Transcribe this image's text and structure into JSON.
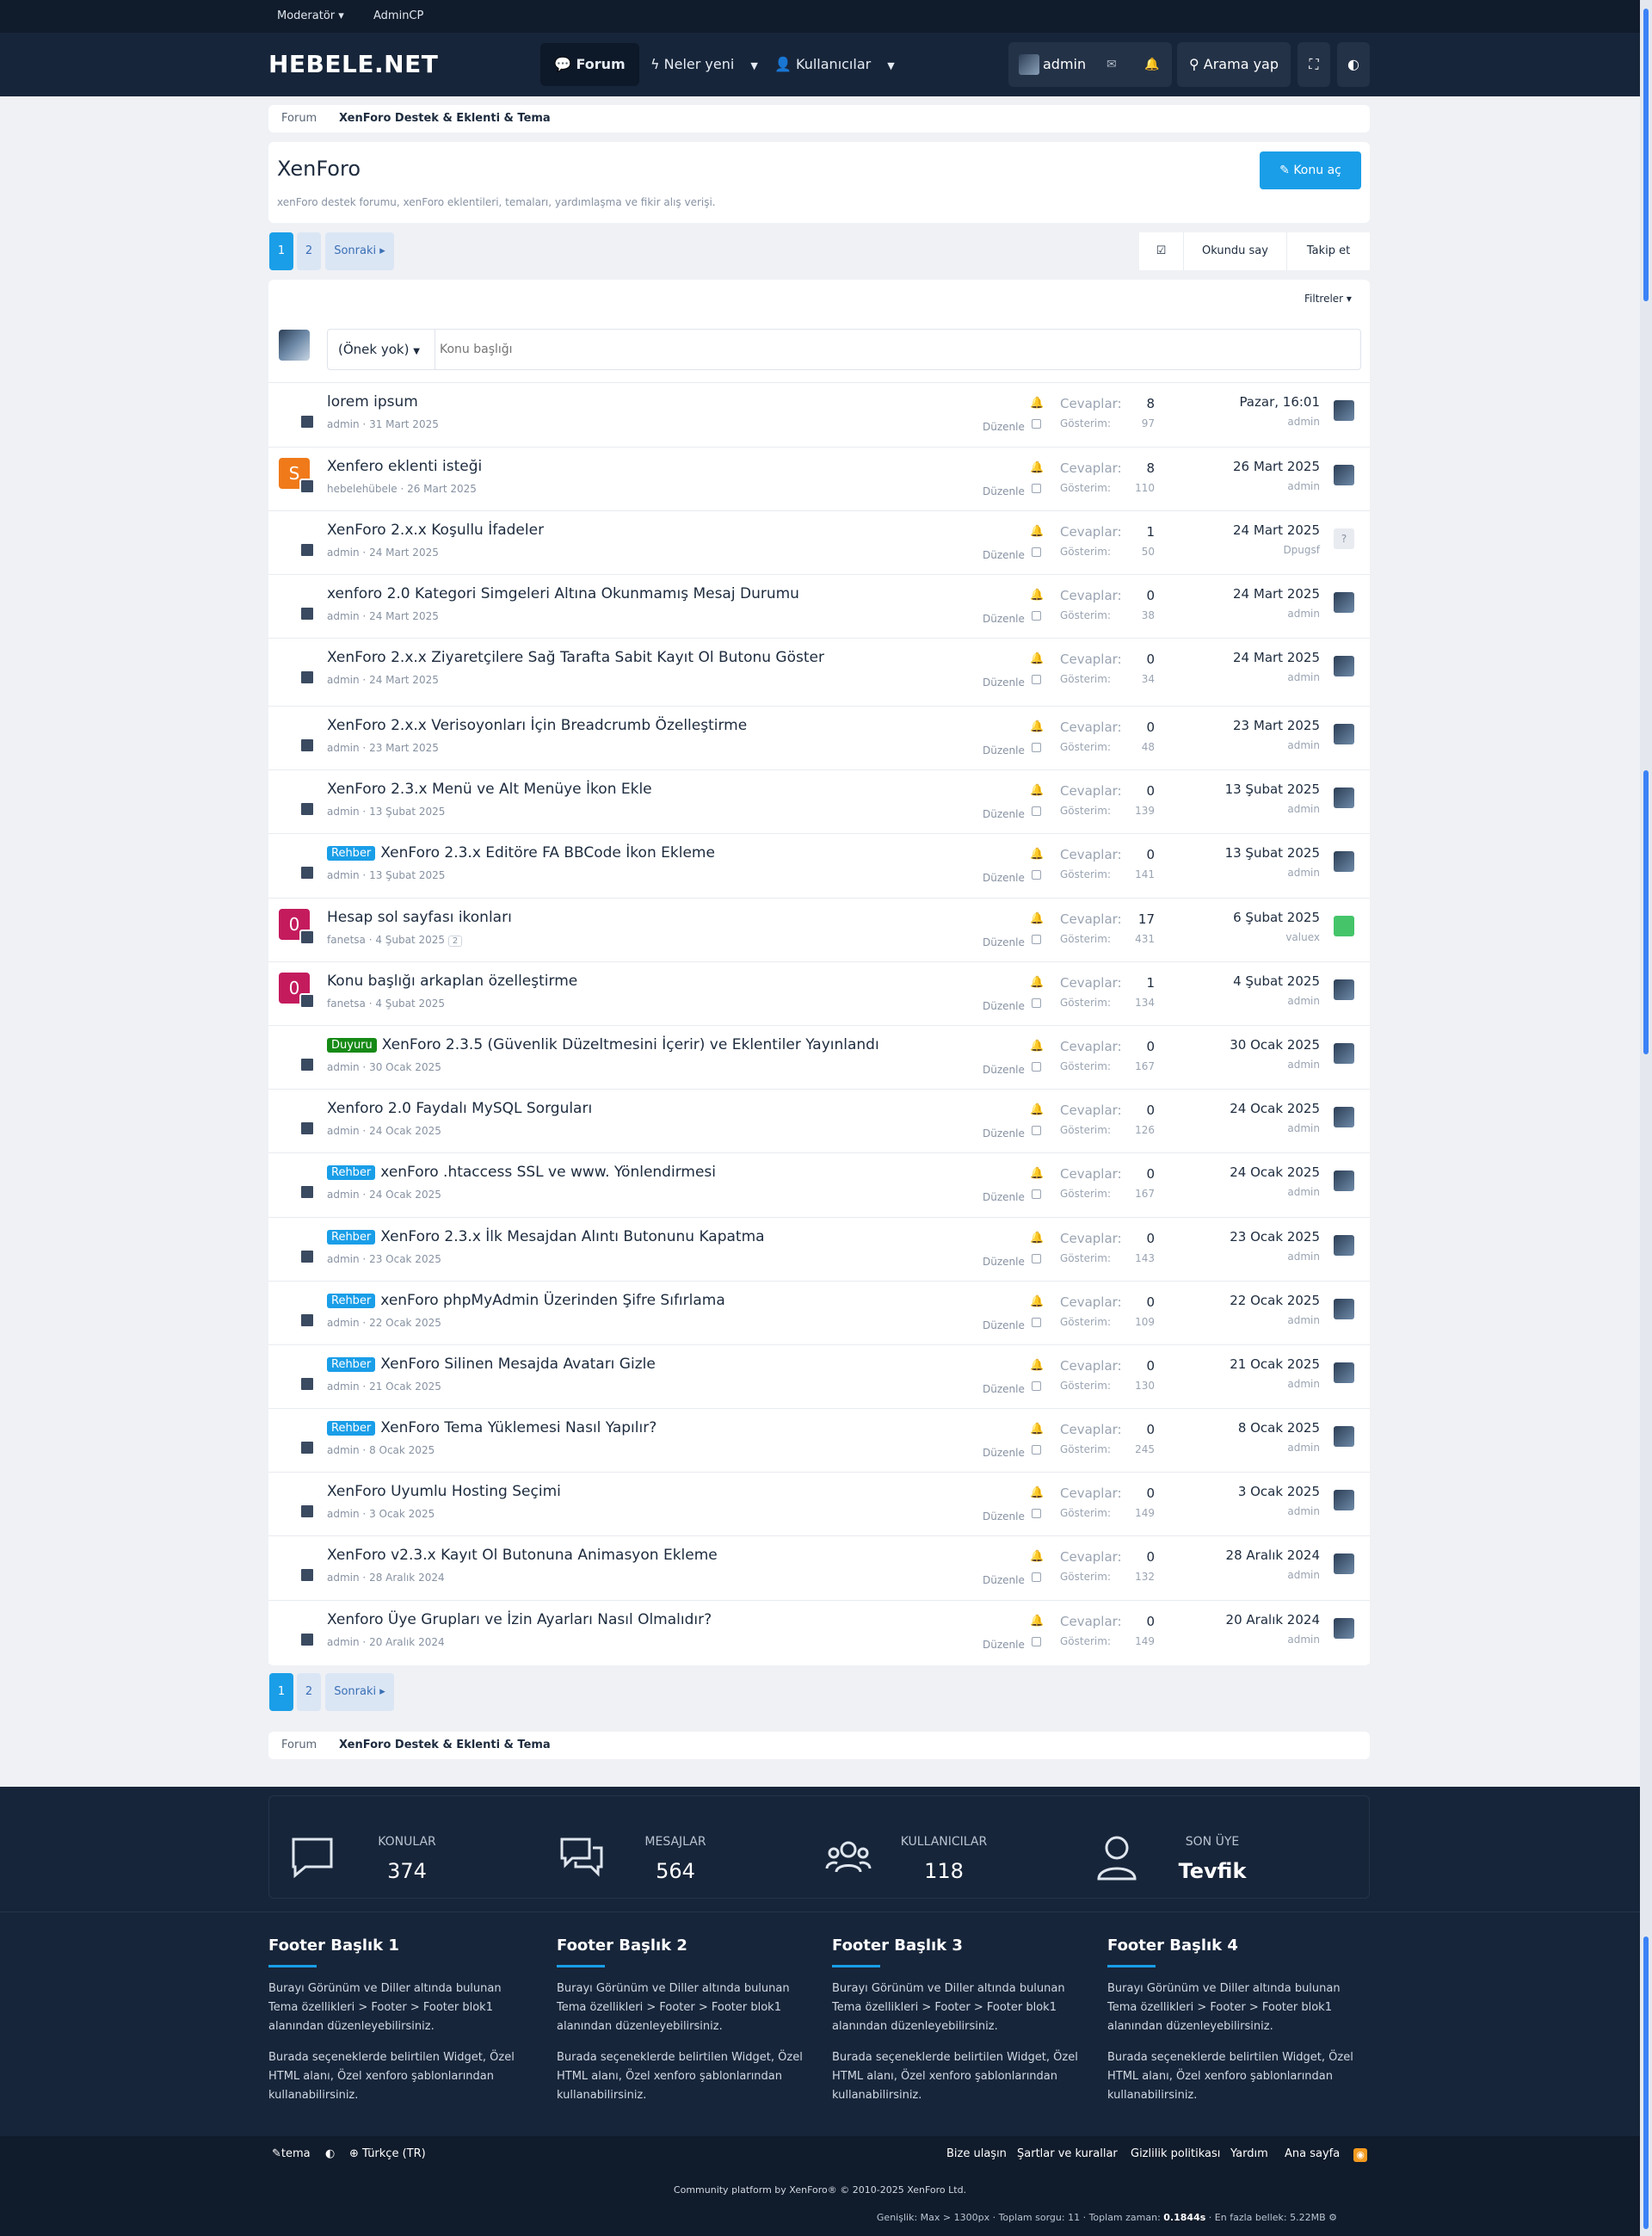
{
  "staffbar": {
    "moderator": "Moderatör ▾",
    "admincp": "AdminCP"
  },
  "nav": {
    "logo": "HEBELE.NET",
    "tabs": [
      {
        "label": "Forum"
      },
      {
        "label": "Neler yeni"
      },
      {
        "label": "Kullanıcılar"
      }
    ],
    "user": "admin",
    "search": "Arama yap"
  },
  "breadcrumb": {
    "root": "Forum",
    "current": "XenForo Destek & Eklenti & Tema"
  },
  "header": {
    "title": "XenForo",
    "description": "xenForo destek forumu, xenForo eklentileri, temaları, yardımlaşma ve fikir alış verişi.",
    "new_thread": "Konu aç"
  },
  "pagination": {
    "pages": [
      "1",
      "2"
    ],
    "next": "Sonraki ▸"
  },
  "actions": {
    "mark_read": "Okundu say",
    "watch": "Takip et",
    "filters": "Filtreler ▾"
  },
  "quick": {
    "prefix": "(Önek yok)",
    "placeholder": "Konu başlığı"
  },
  "labels": {
    "replies": "Cevaplar:",
    "views": "Gösterim:",
    "edit": "Düzenle"
  },
  "threads": [
    {
      "prefix": "",
      "prefix_color": "",
      "title": "lorem ipsum",
      "author": "admin",
      "date": "31 Mart 2025",
      "replies": "8",
      "views": "97",
      "last_date": "Pazar, 16:01",
      "last_user": "admin",
      "avatar": "img",
      "last_avatar": "img",
      "pages": ""
    },
    {
      "prefix": "",
      "prefix_color": "",
      "title": "Xenfero eklenti isteği",
      "author": "hebelehübele",
      "date": "26 Mart 2025",
      "replies": "8",
      "views": "110",
      "last_date": "26 Mart 2025",
      "last_user": "admin",
      "avatar": "S",
      "last_avatar": "img",
      "pages": ""
    },
    {
      "prefix": "",
      "prefix_color": "",
      "title": "XenForo 2.x.x Koşullu İfadeler",
      "author": "admin",
      "date": "24 Mart 2025",
      "replies": "1",
      "views": "50",
      "last_date": "24 Mart 2025",
      "last_user": "Dpugsf",
      "avatar": "img",
      "last_avatar": "?",
      "pages": ""
    },
    {
      "prefix": "",
      "prefix_color": "",
      "title": "xenforo 2.0 Kategori Simgeleri Altına Okunmamış Mesaj Durumu",
      "author": "admin",
      "date": "24 Mart 2025",
      "replies": "0",
      "views": "38",
      "last_date": "24 Mart 2025",
      "last_user": "admin",
      "avatar": "img",
      "last_avatar": "img",
      "pages": ""
    },
    {
      "prefix": "",
      "prefix_color": "",
      "title": "XenForo 2.x.x Ziyaretçilere Sağ Tarafta Sabit Kayıt Ol Butonu Göster",
      "author": "admin",
      "date": "24 Mart 2025",
      "replies": "0",
      "views": "34",
      "last_date": "24 Mart 2025",
      "last_user": "admin",
      "avatar": "img",
      "last_avatar": "img",
      "pages": ""
    },
    {
      "prefix": "",
      "prefix_color": "",
      "title": "XenForo 2.x.x Verisoyonları İçin Breadcrumb Özelleştirme",
      "author": "admin",
      "date": "23 Mart 2025",
      "replies": "0",
      "views": "48",
      "last_date": "23 Mart 2025",
      "last_user": "admin",
      "avatar": "img",
      "last_avatar": "img",
      "pages": ""
    },
    {
      "prefix": "",
      "prefix_color": "",
      "title": "XenForo 2.3.x Menü ve Alt Menüye İkon Ekle",
      "author": "admin",
      "date": "13 Şubat 2025",
      "replies": "0",
      "views": "139",
      "last_date": "13 Şubat 2025",
      "last_user": "admin",
      "avatar": "img",
      "last_avatar": "img",
      "pages": ""
    },
    {
      "prefix": "Rehber",
      "prefix_color": "#1a9ee8",
      "title": "XenForo 2.3.x Editöre FA BBCode İkon Ekleme",
      "author": "admin",
      "date": "13 Şubat 2025",
      "replies": "0",
      "views": "141",
      "last_date": "13 Şubat 2025",
      "last_user": "admin",
      "avatar": "img",
      "last_avatar": "img",
      "pages": ""
    },
    {
      "prefix": "",
      "prefix_color": "",
      "title": "Hesap sol sayfası ikonları",
      "author": "fanetsa",
      "date": "4 Şubat 2025",
      "replies": "17",
      "views": "431",
      "last_date": "6 Şubat 2025",
      "last_user": "valuex",
      "avatar": "0",
      "last_avatar": "green",
      "pages": "2"
    },
    {
      "prefix": "",
      "prefix_color": "",
      "title": "Konu başlığı arkaplan özelleştirme",
      "author": "fanetsa",
      "date": "4 Şubat 2025",
      "replies": "1",
      "views": "134",
      "last_date": "4 Şubat 2025",
      "last_user": "admin",
      "avatar": "0",
      "last_avatar": "img",
      "pages": ""
    },
    {
      "prefix": "Duyuru",
      "prefix_color": "#168a16",
      "title": "XenForo 2.3.5 (Güvenlik Düzeltmesini İçerir) ve Eklentiler Yayınlandı",
      "author": "admin",
      "date": "30 Ocak 2025",
      "replies": "0",
      "views": "167",
      "last_date": "30 Ocak 2025",
      "last_user": "admin",
      "avatar": "img",
      "last_avatar": "img",
      "pages": ""
    },
    {
      "prefix": "",
      "prefix_color": "",
      "title": "Xenforo 2.0 Faydalı MySQL Sorguları",
      "author": "admin",
      "date": "24 Ocak 2025",
      "replies": "0",
      "views": "126",
      "last_date": "24 Ocak 2025",
      "last_user": "admin",
      "avatar": "img",
      "last_avatar": "img",
      "pages": ""
    },
    {
      "prefix": "Rehber",
      "prefix_color": "#1a9ee8",
      "title": "xenForo .htaccess SSL ve www. Yönlendirmesi",
      "author": "admin",
      "date": "24 Ocak 2025",
      "replies": "0",
      "views": "167",
      "last_date": "24 Ocak 2025",
      "last_user": "admin",
      "avatar": "img",
      "last_avatar": "img",
      "pages": ""
    },
    {
      "prefix": "Rehber",
      "prefix_color": "#1a9ee8",
      "title": "XenForo 2.3.x İlk Mesajdan Alıntı Butonunu Kapatma",
      "author": "admin",
      "date": "23 Ocak 2025",
      "replies": "0",
      "views": "143",
      "last_date": "23 Ocak 2025",
      "last_user": "admin",
      "avatar": "img",
      "last_avatar": "img",
      "pages": ""
    },
    {
      "prefix": "Rehber",
      "prefix_color": "#1a9ee8",
      "title": "xenForo phpMyAdmin Üzerinden Şifre Sıfırlama",
      "author": "admin",
      "date": "22 Ocak 2025",
      "replies": "0",
      "views": "109",
      "last_date": "22 Ocak 2025",
      "last_user": "admin",
      "avatar": "img",
      "last_avatar": "img",
      "pages": ""
    },
    {
      "prefix": "Rehber",
      "prefix_color": "#1a9ee8",
      "title": "XenForo Silinen Mesajda Avatarı Gizle",
      "author": "admin",
      "date": "21 Ocak 2025",
      "replies": "0",
      "views": "130",
      "last_date": "21 Ocak 2025",
      "last_user": "admin",
      "avatar": "img",
      "last_avatar": "img",
      "pages": ""
    },
    {
      "prefix": "Rehber",
      "prefix_color": "#1a9ee8",
      "title": "XenForo Tema Yüklemesi Nasıl Yapılır?",
      "author": "admin",
      "date": "8 Ocak 2025",
      "replies": "0",
      "views": "245",
      "last_date": "8 Ocak 2025",
      "last_user": "admin",
      "avatar": "img",
      "last_avatar": "img",
      "pages": ""
    },
    {
      "prefix": "",
      "prefix_color": "",
      "title": "XenForo Uyumlu Hosting Seçimi",
      "author": "admin",
      "date": "3 Ocak 2025",
      "replies": "0",
      "views": "149",
      "last_date": "3 Ocak 2025",
      "last_user": "admin",
      "avatar": "img",
      "last_avatar": "img",
      "pages": ""
    },
    {
      "prefix": "",
      "prefix_color": "",
      "title": "XenForo v2.3.x Kayıt Ol Butonuna Animasyon Ekleme",
      "author": "admin",
      "date": "28 Aralık 2024",
      "replies": "0",
      "views": "132",
      "last_date": "28 Aralık 2024",
      "last_user": "admin",
      "avatar": "img",
      "last_avatar": "img",
      "pages": ""
    },
    {
      "prefix": "",
      "prefix_color": "",
      "title": "Xenforo Üye Grupları ve İzin Ayarları Nasıl Olmalıdır?",
      "author": "admin",
      "date": "20 Aralık 2024",
      "replies": "0",
      "views": "149",
      "last_date": "20 Aralık 2024",
      "last_user": "admin",
      "avatar": "img",
      "last_avatar": "img",
      "pages": ""
    }
  ],
  "stats": [
    {
      "label": "KONULAR",
      "value": "374"
    },
    {
      "label": "MESAJLAR",
      "value": "564"
    },
    {
      "label": "KULLANICILAR",
      "value": "118"
    },
    {
      "label": "SON ÜYE",
      "value": "Tevfik"
    }
  ],
  "footer_cols": [
    {
      "title": "Footer Başlık 1",
      "p1": "Burayı Görünüm ve Diller altında bulunan Tema özellikleri > Footer > Footer blok1 alanından düzenleyebilirsiniz.",
      "p2": "Burada seçeneklerde belirtilen Widget, Özel HTML alanı, Özel xenforo şablonlarından kullanabilirsiniz."
    },
    {
      "title": "Footer Başlık 2",
      "p1": "Burayı Görünüm ve Diller altında bulunan Tema özellikleri > Footer > Footer blok1 alanından düzenleyebilirsiniz.",
      "p2": "Burada seçeneklerde belirtilen Widget, Özel HTML alanı, Özel xenforo şablonlarından kullanabilirsiniz."
    },
    {
      "title": "Footer Başlık 3",
      "p1": "Burayı Görünüm ve Diller altında bulunan Tema özellikleri > Footer > Footer blok1 alanından düzenleyebilirsiniz.",
      "p2": "Burada seçeneklerde belirtilen Widget, Özel HTML alanı, Özel xenforo şablonlarından kullanabilirsiniz."
    },
    {
      "title": "Footer Başlık 4",
      "p1": "Burayı Görünüm ve Diller altında bulunan Tema özellikleri > Footer > Footer blok1 alanından düzenleyebilirsiniz.",
      "p2": "Burada seçeneklerde belirtilen Widget, Özel HTML alanı, Özel xenforo şablonlarından kullanabilirsiniz."
    }
  ],
  "footer": {
    "style": "tema",
    "language": "Türkçe (TR)",
    "links": [
      "Bize ulaşın",
      "Şartlar ve kurallar",
      "Gizlilik politikası",
      "Yardım",
      "Ana sayfa"
    ],
    "copyright": "Community platform by XenForo® © 2010-2025 XenForo Ltd.",
    "debug_prefix": "Genişlik: Max > 1300px · Toplam sorgu: 11 · Toplam zaman: ",
    "debug_time": "0.1844s",
    "debug_suffix": " · En fazla bellek: 5.22MB"
  },
  "colors": {
    "accent": "#1a9ee8",
    "dark": "#17253a",
    "prefix_guide": "#1a9ee8",
    "prefix_announce": "#168a16"
  }
}
